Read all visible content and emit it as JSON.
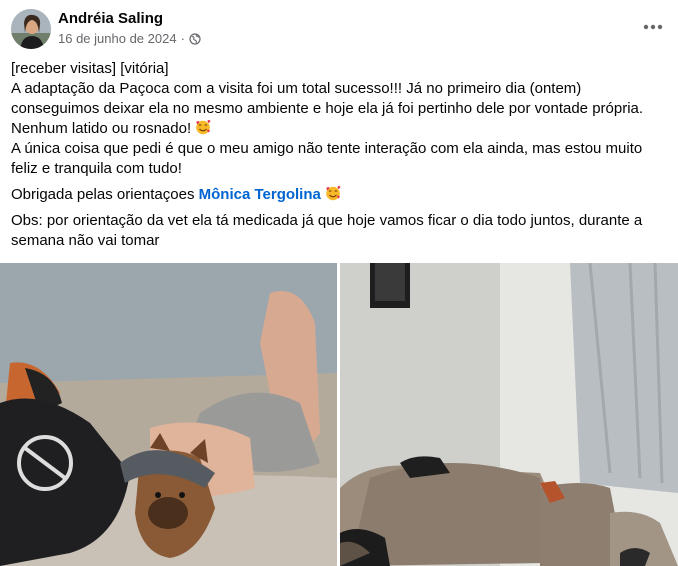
{
  "post": {
    "author": "Andréia Saling",
    "date": "16 de junho de 2024",
    "separator": "·",
    "privacy_icon": "globe-icon",
    "more_icon": "more-options-icon",
    "lines": {
      "tags": "[receber visitas] [vitória]",
      "p1": "A adaptação da Paçoca com a visita foi um total sucesso!!! Já no primeiro dia (ontem) conseguimos deixar ela no mesmo ambiente e hoje ela já foi pertinho dele por vontade própria. Nenhum latido ou rosnado!",
      "p2": "A única coisa que pedi é que o meu amigo não tente interação com ela ainda, mas estou muito feliz e tranquila com tudo!",
      "p3_prefix": "Obrigada pelas orientaçoes ",
      "mention": "Mônica Tergolina",
      "p4": "Obs: por orientação da vet ela tá medicada já que hoje vamos ficar o dia todo juntos, durante a semana não vai tomar"
    },
    "emoji": "smiling-face-with-hearts"
  }
}
